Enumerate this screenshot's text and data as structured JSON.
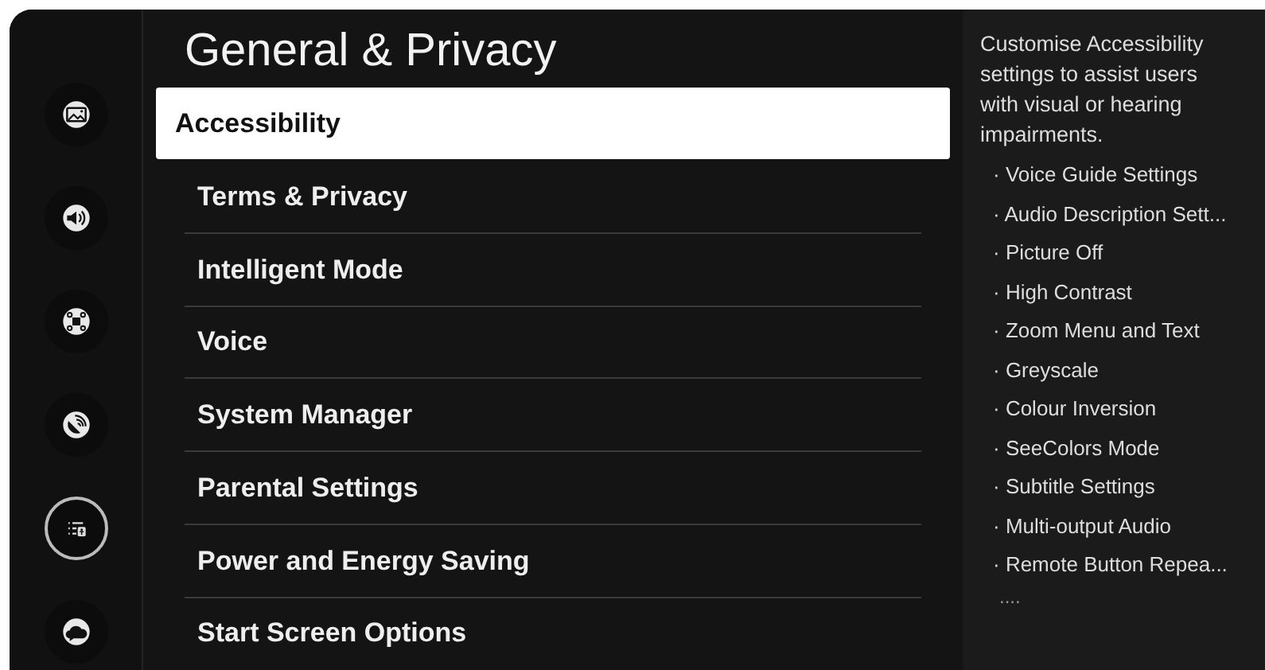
{
  "sidebar": {
    "items": [
      {
        "selected": false
      },
      {
        "selected": false
      },
      {
        "selected": false
      },
      {
        "selected": false
      },
      {
        "selected": true
      },
      {
        "selected": false
      }
    ]
  },
  "title": "General & Privacy",
  "menu": {
    "items": [
      {
        "label": "Accessibility",
        "selected": true
      },
      {
        "label": "Terms & Privacy",
        "selected": false
      },
      {
        "label": "Intelligent Mode",
        "selected": false
      },
      {
        "label": "Voice",
        "selected": false
      },
      {
        "label": "System Manager",
        "selected": false
      },
      {
        "label": "Parental Settings",
        "selected": false
      },
      {
        "label": "Power and Energy Saving",
        "selected": false
      },
      {
        "label": "Start Screen Options",
        "selected": false
      }
    ]
  },
  "description": {
    "text": "Customise Accessibility settings to assist users with visual or hearing impairments.",
    "items": [
      "· Voice Guide Settings",
      "· Audio Description Sett...",
      "· Picture Off",
      "· High Contrast",
      "· Zoom Menu and Text",
      "· Greyscale",
      "· Colour Inversion",
      "· SeeColors Mode",
      "· Subtitle Settings",
      "· Multi-output Audio",
      "· Remote Button Repea..."
    ],
    "more": "...."
  }
}
